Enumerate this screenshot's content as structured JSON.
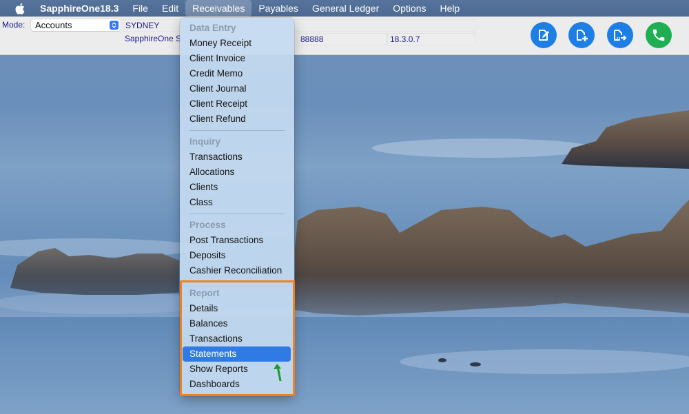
{
  "menubar": {
    "apple_icon": "apple-logo-icon",
    "app_name": "SapphireOne18.3",
    "items": [
      "File",
      "Edit",
      "Receivables",
      "Payables",
      "General Ledger",
      "Options",
      "Help"
    ],
    "active_item": "Receivables"
  },
  "toolbar": {
    "mode_label": "Mode:",
    "mode_value": "Accounts",
    "location": "SYDNEY",
    "company": "SapphireOne S",
    "account_number": "88888",
    "version": "18.3.0.7",
    "buttons": [
      {
        "name": "edit-document",
        "icon": "document-pencil-icon",
        "color": "#1d7fe6"
      },
      {
        "name": "new-document",
        "icon": "document-plus-icon",
        "color": "#1d7fe6"
      },
      {
        "name": "export-document",
        "icon": "document-arrow-icon",
        "color": "#1d7fe6"
      },
      {
        "name": "phone",
        "icon": "phone-icon",
        "color": "#1fae52"
      }
    ]
  },
  "receivables_menu": {
    "sections": [
      {
        "header": "Data Entry",
        "items": [
          "Money Receipt",
          "Client Invoice",
          "Credit Memo",
          "Client Journal",
          "Client Receipt",
          "Client Refund"
        ]
      },
      {
        "header": "Inquiry",
        "items": [
          "Transactions",
          "Allocations",
          "Clients",
          "Class"
        ]
      },
      {
        "header": "Process",
        "items": [
          "Post Transactions",
          "Deposits",
          "Cashier Reconciliation"
        ]
      },
      {
        "header": "Report",
        "items": [
          "Details",
          "Balances",
          "Transactions",
          "Statements",
          "Show Reports",
          "Dashboards"
        ]
      }
    ],
    "selected_item": "Statements"
  },
  "annotations": {
    "highlight_color": "#f0821e",
    "arrow_color": "#1a9a2a"
  }
}
